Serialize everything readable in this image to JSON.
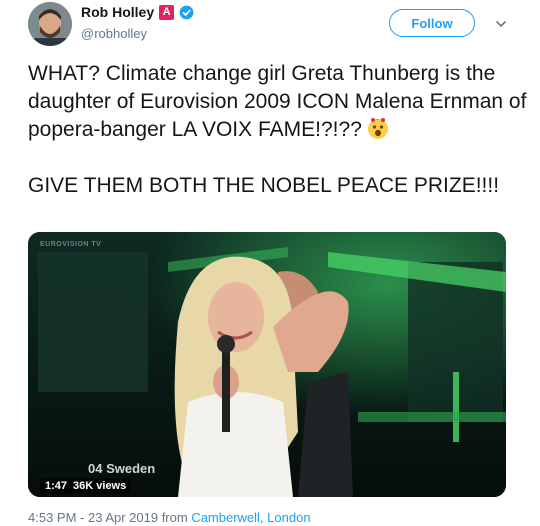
{
  "author": {
    "display_name": "Rob Holley",
    "badge_letter": "A",
    "handle": "@robholley",
    "verified": true,
    "accent_color": "#1da1f2"
  },
  "header": {
    "follow_label": "Follow"
  },
  "tweet": {
    "line1": "WHAT? Climate change girl Greta Thunberg is the daughter of Eurovision 2009 ICON Malena Ernman of popera-banger LA VOIX FAME!?!??",
    "emoji": "astonished-face",
    "line2": "GIVE THEM BOTH THE NOBEL PEACE PRIZE!!!!"
  },
  "media": {
    "watermark": "EUROVISION TV",
    "caption": "04  Sweden",
    "duration": "1:47",
    "views": "36K views"
  },
  "footer": {
    "timestamp": "4:53 PM - 23 Apr 2019 from ",
    "location": "Camberwell, London"
  }
}
